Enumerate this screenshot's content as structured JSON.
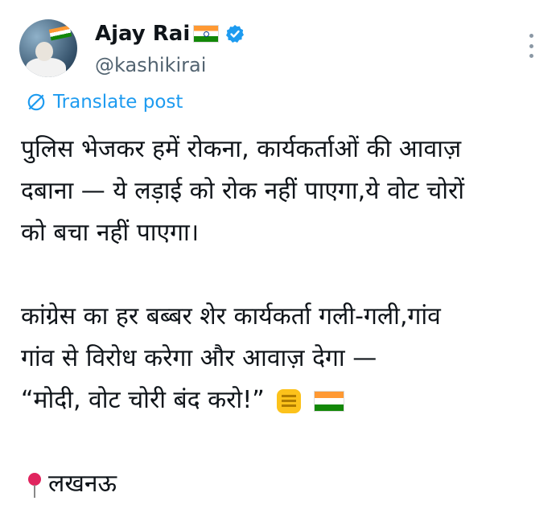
{
  "author": {
    "name": "Ajay Rai",
    "handle": "@kashikirai"
  },
  "translate_label": "Translate post",
  "post": {
    "lines1": [
      "पुलिस भेजकर हमें रोकना, कार्यकर्ताओं की आवाज़",
      "दबाना — ये लड़ाई को रोक नहीं पाएगा,ये वोट चोरों",
      "को बचा नहीं पाएगा।"
    ],
    "lines2": [
      "कांग्रेस का हर बब्बर शेर कार्यकर्ता गली-गली,गांव",
      "गांव से विरोध करेगा और आवाज़ देगा —"
    ],
    "slogan": "“मोदी, वोट चोरी बंद करो!”",
    "location": "लखनऊ"
  },
  "icons": {
    "verified": "verified-badge-icon",
    "more": "more-options-icon",
    "translate": "translate-globe-icon",
    "fist": "raised-fist-emoji",
    "flag": "india-flag-emoji",
    "pin": "round-pushpin-emoji"
  },
  "colors": {
    "link": "#1d9bf0",
    "secondary": "#536471",
    "verified": "#1d9bf0"
  }
}
